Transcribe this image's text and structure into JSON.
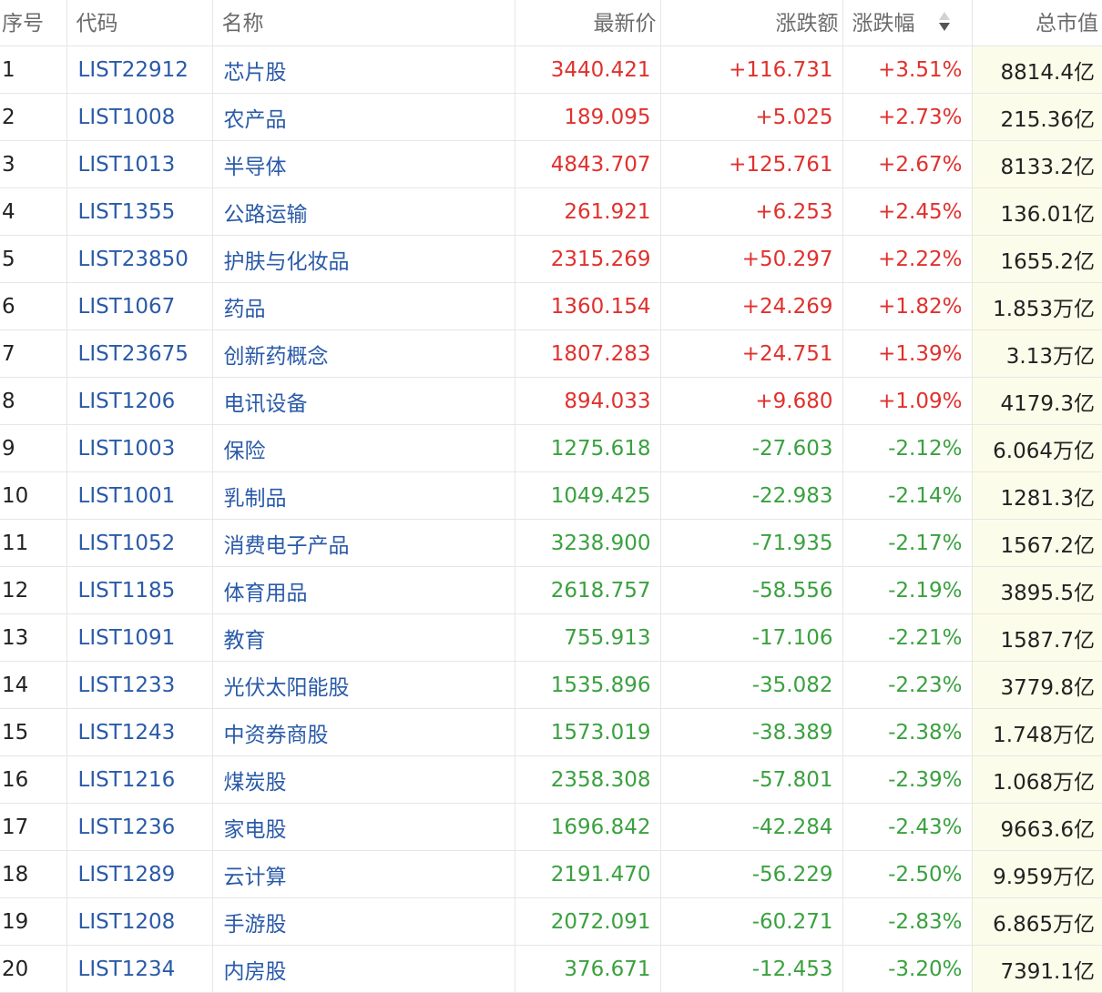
{
  "colors": {
    "rise": "#e0312d",
    "fall": "#3aa13f",
    "link": "#2a5aa8",
    "header_text": "#6b6b6b",
    "highlight_column": "#fcfcea"
  },
  "headers": {
    "index": "序号",
    "code": "代码",
    "name": "名称",
    "price": "最新价",
    "change": "涨跌额",
    "change_pct": "涨跌幅",
    "market_cap": "总市值"
  },
  "sort": {
    "column": "change_pct",
    "icon": "sort-desc-icon"
  },
  "rows": [
    {
      "index": "1",
      "code": "LIST22912",
      "name": "芯片股",
      "price": "3440.421",
      "change": "+116.731",
      "change_pct": "+3.51%",
      "market_cap": "8814.4亿",
      "direction": "up"
    },
    {
      "index": "2",
      "code": "LIST1008",
      "name": "农产品",
      "price": "189.095",
      "change": "+5.025",
      "change_pct": "+2.73%",
      "market_cap": "215.36亿",
      "direction": "up"
    },
    {
      "index": "3",
      "code": "LIST1013",
      "name": "半导体",
      "price": "4843.707",
      "change": "+125.761",
      "change_pct": "+2.67%",
      "market_cap": "8133.2亿",
      "direction": "up"
    },
    {
      "index": "4",
      "code": "LIST1355",
      "name": "公路运输",
      "price": "261.921",
      "change": "+6.253",
      "change_pct": "+2.45%",
      "market_cap": "136.01亿",
      "direction": "up"
    },
    {
      "index": "5",
      "code": "LIST23850",
      "name": "护肤与化妆品",
      "price": "2315.269",
      "change": "+50.297",
      "change_pct": "+2.22%",
      "market_cap": "1655.2亿",
      "direction": "up"
    },
    {
      "index": "6",
      "code": "LIST1067",
      "name": "药品",
      "price": "1360.154",
      "change": "+24.269",
      "change_pct": "+1.82%",
      "market_cap": "1.853万亿",
      "direction": "up"
    },
    {
      "index": "7",
      "code": "LIST23675",
      "name": "创新药概念",
      "price": "1807.283",
      "change": "+24.751",
      "change_pct": "+1.39%",
      "market_cap": "3.13万亿",
      "direction": "up"
    },
    {
      "index": "8",
      "code": "LIST1206",
      "name": "电讯设备",
      "price": "894.033",
      "change": "+9.680",
      "change_pct": "+1.09%",
      "market_cap": "4179.3亿",
      "direction": "up"
    },
    {
      "index": "9",
      "code": "LIST1003",
      "name": "保险",
      "price": "1275.618",
      "change": "-27.603",
      "change_pct": "-2.12%",
      "market_cap": "6.064万亿",
      "direction": "down"
    },
    {
      "index": "10",
      "code": "LIST1001",
      "name": "乳制品",
      "price": "1049.425",
      "change": "-22.983",
      "change_pct": "-2.14%",
      "market_cap": "1281.3亿",
      "direction": "down"
    },
    {
      "index": "11",
      "code": "LIST1052",
      "name": "消费电子产品",
      "price": "3238.900",
      "change": "-71.935",
      "change_pct": "-2.17%",
      "market_cap": "1567.2亿",
      "direction": "down"
    },
    {
      "index": "12",
      "code": "LIST1185",
      "name": "体育用品",
      "price": "2618.757",
      "change": "-58.556",
      "change_pct": "-2.19%",
      "market_cap": "3895.5亿",
      "direction": "down"
    },
    {
      "index": "13",
      "code": "LIST1091",
      "name": "教育",
      "price": "755.913",
      "change": "-17.106",
      "change_pct": "-2.21%",
      "market_cap": "1587.7亿",
      "direction": "down"
    },
    {
      "index": "14",
      "code": "LIST1233",
      "name": "光伏太阳能股",
      "price": "1535.896",
      "change": "-35.082",
      "change_pct": "-2.23%",
      "market_cap": "3779.8亿",
      "direction": "down"
    },
    {
      "index": "15",
      "code": "LIST1243",
      "name": "中资券商股",
      "price": "1573.019",
      "change": "-38.389",
      "change_pct": "-2.38%",
      "market_cap": "1.748万亿",
      "direction": "down"
    },
    {
      "index": "16",
      "code": "LIST1216",
      "name": "煤炭股",
      "price": "2358.308",
      "change": "-57.801",
      "change_pct": "-2.39%",
      "market_cap": "1.068万亿",
      "direction": "down"
    },
    {
      "index": "17",
      "code": "LIST1236",
      "name": "家电股",
      "price": "1696.842",
      "change": "-42.284",
      "change_pct": "-2.43%",
      "market_cap": "9663.6亿",
      "direction": "down"
    },
    {
      "index": "18",
      "code": "LIST1289",
      "name": "云计算",
      "price": "2191.470",
      "change": "-56.229",
      "change_pct": "-2.50%",
      "market_cap": "9.959万亿",
      "direction": "down"
    },
    {
      "index": "19",
      "code": "LIST1208",
      "name": "手游股",
      "price": "2072.091",
      "change": "-60.271",
      "change_pct": "-2.83%",
      "market_cap": "6.865万亿",
      "direction": "down"
    },
    {
      "index": "20",
      "code": "LIST1234",
      "name": "内房股",
      "price": "376.671",
      "change": "-12.453",
      "change_pct": "-3.20%",
      "market_cap": "7391.1亿",
      "direction": "down"
    }
  ]
}
